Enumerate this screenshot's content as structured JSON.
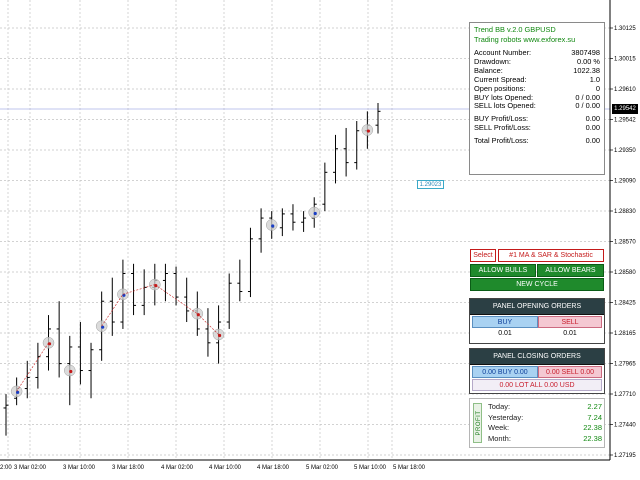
{
  "info_panel": {
    "title": "Trend BB v.2.0 GBPUSD",
    "subtitle": "Trading robots www.exforex.su",
    "rows1": [
      {
        "label": "Account Number:",
        "value": "3807498"
      },
      {
        "label": "Drawdown:",
        "value": "0.00 %"
      },
      {
        "label": "Balance:",
        "value": "1022.38"
      },
      {
        "label": "Current Spread:",
        "value": "1.0"
      },
      {
        "label": "Open positions:",
        "value": "0"
      },
      {
        "label": "BUY lots Opened:",
        "value": "0 / 0.00"
      },
      {
        "label": "SELL lots Opened:",
        "value": "0 / 0.00"
      }
    ],
    "rows2": [
      {
        "label": "BUY Profit/Loss:",
        "value": "0.00"
      },
      {
        "label": "SELL Profit/Loss:",
        "value": "0.00"
      }
    ],
    "total": {
      "label": "Total Profit/Loss:",
      "value": "0.00"
    }
  },
  "controls": {
    "select": "Select",
    "strategy": "#1 MA & SAR & Stochastic",
    "allow_bulls": "ALLOW BULLS",
    "allow_bears": "ALLOW BEARS",
    "new_cycle": "NEW CYCLE"
  },
  "opening_panel": {
    "title": "PANEL OPENING ORDERS",
    "buy": "BUY",
    "sell": "SELL",
    "buy_lot": "0.01",
    "sell_lot": "0.01"
  },
  "closing_panel": {
    "title": "PANEL CLOSING ORDERS",
    "buy": "0.00 BUY 0.00",
    "sell": "0.00 SELL 0.00",
    "all": "0.00 LOT    ALL    0.00 USD"
  },
  "profit_panel": {
    "side_label": "PROFIT",
    "rows": [
      {
        "label": "Today:",
        "value": "2.27"
      },
      {
        "label": "Yesterday:",
        "value": "7.24"
      },
      {
        "label": "Week:",
        "value": "22.38"
      },
      {
        "label": "Month:",
        "value": "22.38"
      }
    ]
  },
  "price_tag": "1.29023",
  "current_price": "1.29542",
  "y_axis_labels": [
    "1.30125",
    "1.30015",
    "1.29610",
    "1.29542",
    "1.29350",
    "1.29090",
    "1.28830",
    "1.28570",
    "1.28580",
    "1.28425",
    "1.28165",
    "1.27965",
    "1.27710",
    "1.27440",
    "1.27195"
  ],
  "x_axis_labels": [
    "3 Mar 02:00",
    "3 Mar 10:00",
    "3 Mar 18:00",
    "4 Mar 02:00",
    "4 Mar 10:00",
    "4 Mar 18:00",
    "5 Mar 02:00",
    "5 Mar 10:00",
    "5 Mar 18:00"
  ],
  "x_axis_first": "2:00",
  "chart_data": {
    "type": "candlestick",
    "symbol": "GBPUSD",
    "x_tick_labels": [
      "3 Mar 02:00",
      "3 Mar 10:00",
      "3 Mar 18:00",
      "4 Mar 02:00",
      "4 Mar 10:00",
      "4 Mar 18:00",
      "5 Mar 02:00",
      "5 Mar 10:00",
      "5 Mar 18:00"
    ],
    "y_tick_labels": [
      "1.30125",
      "1.30015",
      "1.29610",
      "1.29542",
      "1.29350",
      "1.29090",
      "1.28830",
      "1.28570",
      "1.28580",
      "1.28425",
      "1.28165",
      "1.27965",
      "1.27710",
      "1.27440",
      "1.27195"
    ],
    "current_price": 1.29542,
    "grid": true,
    "bars": [
      {
        "o": 1.2738,
        "h": 1.2748,
        "l": 1.2718,
        "c": 1.274
      },
      {
        "o": 1.2745,
        "h": 1.276,
        "l": 1.274,
        "c": 1.2752
      },
      {
        "o": 1.2752,
        "h": 1.2772,
        "l": 1.2745,
        "c": 1.276
      },
      {
        "o": 1.276,
        "h": 1.2785,
        "l": 1.2752,
        "c": 1.2775
      },
      {
        "o": 1.2775,
        "h": 1.2805,
        "l": 1.2765,
        "c": 1.2795
      },
      {
        "o": 1.2795,
        "h": 1.2815,
        "l": 1.276,
        "c": 1.277
      },
      {
        "o": 1.277,
        "h": 1.279,
        "l": 1.274,
        "c": 1.2782
      },
      {
        "o": 1.2782,
        "h": 1.28,
        "l": 1.2755,
        "c": 1.2765
      },
      {
        "o": 1.2765,
        "h": 1.2785,
        "l": 1.2745,
        "c": 1.278
      },
      {
        "o": 1.278,
        "h": 1.2822,
        "l": 1.2772,
        "c": 1.2815
      },
      {
        "o": 1.2815,
        "h": 1.2832,
        "l": 1.279,
        "c": 1.28
      },
      {
        "o": 1.28,
        "h": 1.2845,
        "l": 1.2795,
        "c": 1.2835
      },
      {
        "o": 1.2835,
        "h": 1.2842,
        "l": 1.2805,
        "c": 1.2812
      },
      {
        "o": 1.2812,
        "h": 1.2838,
        "l": 1.2805,
        "c": 1.2825
      },
      {
        "o": 1.2825,
        "h": 1.2842,
        "l": 1.2812,
        "c": 1.283
      },
      {
        "o": 1.283,
        "h": 1.2842,
        "l": 1.2815,
        "c": 1.2835
      },
      {
        "o": 1.2835,
        "h": 1.284,
        "l": 1.2812,
        "c": 1.2818
      },
      {
        "o": 1.2818,
        "h": 1.2832,
        "l": 1.28,
        "c": 1.2808
      },
      {
        "o": 1.2808,
        "h": 1.2822,
        "l": 1.279,
        "c": 1.2795
      },
      {
        "o": 1.2795,
        "h": 1.281,
        "l": 1.2775,
        "c": 1.2785
      },
      {
        "o": 1.2785,
        "h": 1.2812,
        "l": 1.277,
        "c": 1.28
      },
      {
        "o": 1.28,
        "h": 1.2835,
        "l": 1.2795,
        "c": 1.2828
      },
      {
        "o": 1.2828,
        "h": 1.2845,
        "l": 1.2815,
        "c": 1.2822
      },
      {
        "o": 1.2822,
        "h": 1.2868,
        "l": 1.2818,
        "c": 1.286
      },
      {
        "o": 1.286,
        "h": 1.2882,
        "l": 1.285,
        "c": 1.2875
      },
      {
        "o": 1.2875,
        "h": 1.288,
        "l": 1.286,
        "c": 1.2868
      },
      {
        "o": 1.2868,
        "h": 1.2882,
        "l": 1.2862,
        "c": 1.2878
      },
      {
        "o": 1.2878,
        "h": 1.2885,
        "l": 1.2866,
        "c": 1.2872
      },
      {
        "o": 1.2872,
        "h": 1.288,
        "l": 1.2865,
        "c": 1.2875
      },
      {
        "o": 1.2875,
        "h": 1.289,
        "l": 1.2868,
        "c": 1.2885
      },
      {
        "o": 1.2885,
        "h": 1.2915,
        "l": 1.288,
        "c": 1.2908
      },
      {
        "o": 1.2908,
        "h": 1.2935,
        "l": 1.29,
        "c": 1.2925
      },
      {
        "o": 1.2925,
        "h": 1.294,
        "l": 1.2905,
        "c": 1.2915
      },
      {
        "o": 1.2915,
        "h": 1.2945,
        "l": 1.291,
        "c": 1.2938
      },
      {
        "o": 1.2938,
        "h": 1.2952,
        "l": 1.2925,
        "c": 1.2942
      },
      {
        "o": 1.2942,
        "h": 1.2958,
        "l": 1.2936,
        "c": 1.2952
      }
    ]
  }
}
